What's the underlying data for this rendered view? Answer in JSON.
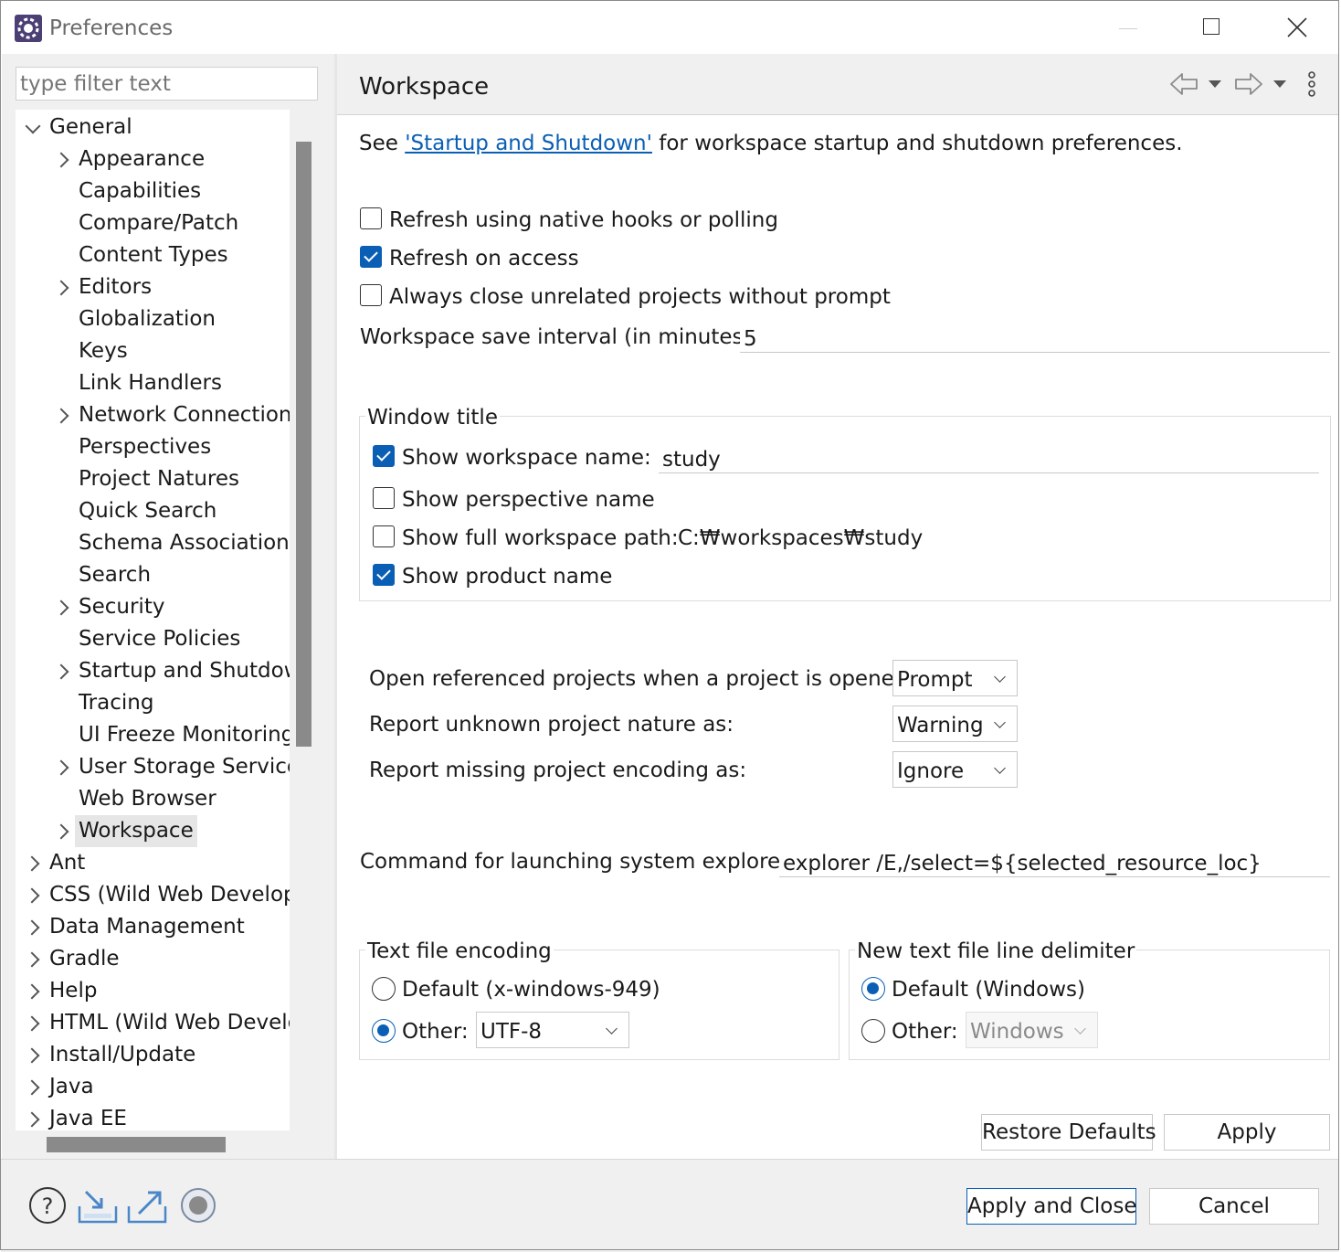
{
  "window": {
    "title": "Preferences"
  },
  "filter": {
    "placeholder": "type filter text"
  },
  "tree": {
    "items": [
      {
        "label": "General",
        "expander": "down",
        "level": 0
      },
      {
        "label": "Appearance",
        "expander": "right",
        "level": 1
      },
      {
        "label": "Capabilities",
        "expander": "",
        "level": 1
      },
      {
        "label": "Compare/Patch",
        "expander": "",
        "level": 1
      },
      {
        "label": "Content Types",
        "expander": "",
        "level": 1
      },
      {
        "label": "Editors",
        "expander": "right",
        "level": 1
      },
      {
        "label": "Globalization",
        "expander": "",
        "level": 1
      },
      {
        "label": "Keys",
        "expander": "",
        "level": 1
      },
      {
        "label": "Link Handlers",
        "expander": "",
        "level": 1
      },
      {
        "label": "Network Connections",
        "expander": "right",
        "level": 1
      },
      {
        "label": "Perspectives",
        "expander": "",
        "level": 1
      },
      {
        "label": "Project Natures",
        "expander": "",
        "level": 1
      },
      {
        "label": "Quick Search",
        "expander": "",
        "level": 1
      },
      {
        "label": "Schema Associations",
        "expander": "",
        "level": 1
      },
      {
        "label": "Search",
        "expander": "",
        "level": 1
      },
      {
        "label": "Security",
        "expander": "right",
        "level": 1
      },
      {
        "label": "Service Policies",
        "expander": "",
        "level": 1
      },
      {
        "label": "Startup and Shutdow",
        "expander": "right",
        "level": 1
      },
      {
        "label": "Tracing",
        "expander": "",
        "level": 1
      },
      {
        "label": "UI Freeze Monitoring",
        "expander": "",
        "level": 1
      },
      {
        "label": "User Storage Service",
        "expander": "right",
        "level": 1
      },
      {
        "label": "Web Browser",
        "expander": "",
        "level": 1
      },
      {
        "label": "Workspace",
        "expander": "right",
        "level": 1,
        "selected": true
      },
      {
        "label": "Ant",
        "expander": "right",
        "level": 0
      },
      {
        "label": "CSS (Wild Web Develop",
        "expander": "right",
        "level": 0
      },
      {
        "label": "Data Management",
        "expander": "right",
        "level": 0
      },
      {
        "label": "Gradle",
        "expander": "right",
        "level": 0
      },
      {
        "label": "Help",
        "expander": "right",
        "level": 0
      },
      {
        "label": "HTML (Wild Web Develc",
        "expander": "right",
        "level": 0
      },
      {
        "label": "Install/Update",
        "expander": "right",
        "level": 0
      },
      {
        "label": "Java",
        "expander": "right",
        "level": 0
      },
      {
        "label": "Java EE",
        "expander": "right",
        "level": 0
      }
    ]
  },
  "page": {
    "title": "Workspace",
    "intro_prefix": "See ",
    "intro_link": "'Startup and Shutdown'",
    "intro_suffix": " for workspace startup and shutdown preferences.",
    "refresh_native": {
      "label": "Refresh using native hooks or polling",
      "checked": false
    },
    "refresh_access": {
      "label": "Refresh on access",
      "checked": true
    },
    "close_unrelated": {
      "label": "Always close unrelated projects without prompt",
      "checked": false
    },
    "save_interval": {
      "label": "Workspace save interval (in minutes):",
      "value": "5"
    },
    "window_title": {
      "group_label": "Window title",
      "show_workspace_name": {
        "label": "Show workspace name:",
        "checked": true,
        "value": "study"
      },
      "show_perspective_name": {
        "label": "Show perspective name",
        "checked": false
      },
      "show_full_path": {
        "label": "Show full workspace path:",
        "checked": false,
        "value": "C:₩workspaces₩study"
      },
      "show_product_name": {
        "label": "Show product name",
        "checked": true
      }
    },
    "open_referenced": {
      "label": "Open referenced projects when a project is opened:",
      "value": "Prompt"
    },
    "unknown_nature": {
      "label": "Report unknown project nature as:",
      "value": "Warning"
    },
    "missing_encoding": {
      "label": "Report missing project encoding as:",
      "value": "Ignore"
    },
    "explorer_command": {
      "label": "Command for launching system explorer:",
      "value": "explorer /E,/select=${selected_resource_loc}"
    },
    "text_encoding": {
      "group_label": "Text file encoding",
      "default_label": "Default (x-windows-949)",
      "other_label": "Other:",
      "other_value": "UTF-8",
      "selected": "other"
    },
    "line_delimiter": {
      "group_label": "New text file line delimiter",
      "default_label": "Default (Windows)",
      "other_label": "Other:",
      "other_value": "Windows",
      "selected": "default"
    },
    "restore_defaults_label": "Restore Defaults",
    "apply_label": "Apply"
  },
  "footer": {
    "apply_close_label": "Apply and Close",
    "cancel_label": "Cancel"
  },
  "colors": {
    "accent": "#0a5fb4",
    "panel": "#f0f0f0",
    "selection": "#e6e6e6"
  }
}
